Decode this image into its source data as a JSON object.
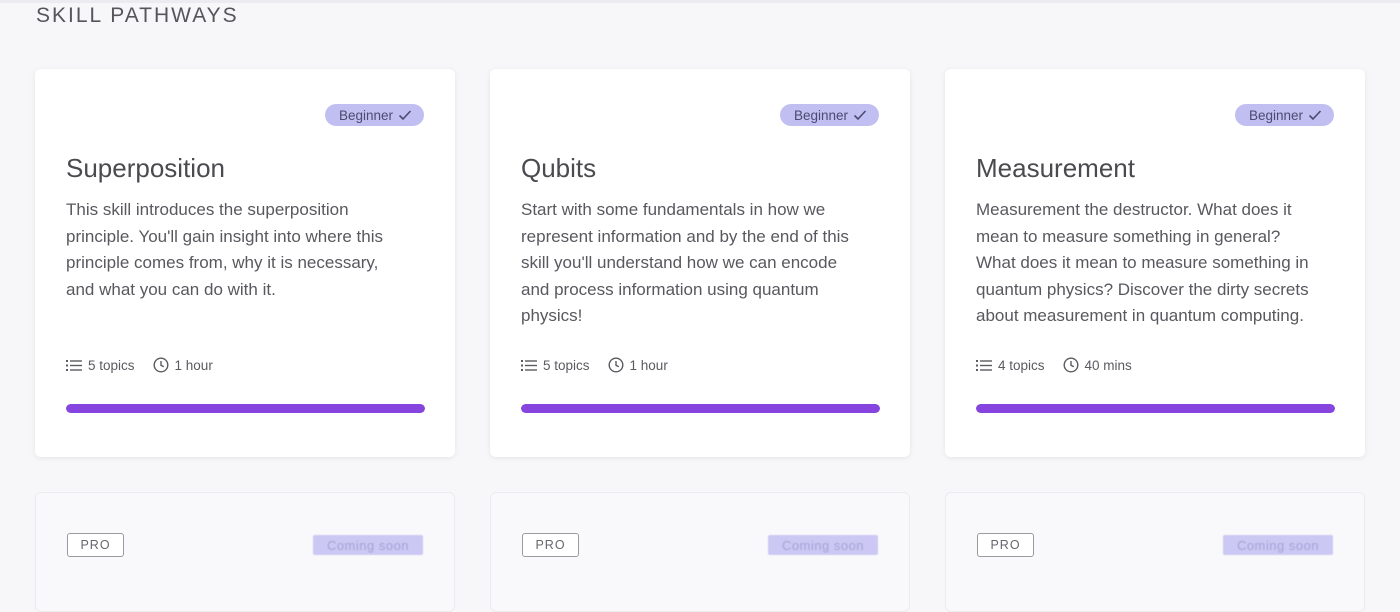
{
  "section": {
    "title": "SKILL PATHWAYS"
  },
  "cards": [
    {
      "level": "Beginner",
      "title": "Superposition",
      "description": "This skill introduces the superposition principle. You'll gain insight into where this principle comes from, why it is necessary, and what you can do with it.",
      "topics": "5 topics",
      "duration": "1 hour",
      "progress": 1.0
    },
    {
      "level": "Beginner",
      "title": "Qubits",
      "description": "Start with some fundamentals in how we represent information and by the end of this skill you'll understand how we can encode and process information using quantum physics!",
      "topics": "5 topics",
      "duration": "1 hour",
      "progress": 1.0
    },
    {
      "level": "Beginner",
      "title": "Measurement",
      "description": "Measurement the destructor. What does it mean to measure something in general? What does it mean to measure something in quantum physics? Discover the dirty secrets about measurement in quantum computing.",
      "topics": "4 topics",
      "duration": "40 mins",
      "progress": 1.0
    }
  ],
  "locked_cards": [
    {
      "tag": "PRO",
      "status": "Coming soon"
    },
    {
      "tag": "PRO",
      "status": "Coming soon"
    },
    {
      "tag": "PRO",
      "status": "Coming soon"
    }
  ],
  "colors": {
    "accent": "#8545de",
    "badge_bg": "#c1bff2",
    "background": "#f7f7f9"
  },
  "icons": {
    "level_check": "check-icon",
    "topics": "list-icon",
    "duration": "clock-icon"
  }
}
